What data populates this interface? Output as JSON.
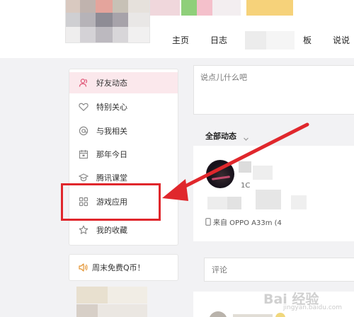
{
  "nav": {
    "items": [
      {
        "label": "主页"
      },
      {
        "label": "日志"
      },
      {
        "label": "板"
      },
      {
        "label": "说说"
      }
    ]
  },
  "sidebar": {
    "items": [
      {
        "label": "好友动态",
        "icon": "friends-icon",
        "active": true
      },
      {
        "label": "特别关心",
        "icon": "heart-icon"
      },
      {
        "label": "与我相关",
        "icon": "at-icon"
      },
      {
        "label": "那年今日",
        "icon": "calendar-icon"
      },
      {
        "label": "腾讯课堂",
        "icon": "graduation-cap-icon"
      },
      {
        "label": "游戏应用",
        "icon": "apps-grid-icon"
      },
      {
        "label": "我的收藏",
        "icon": "star-icon"
      }
    ],
    "promo": {
      "label": "周末免费Q币！",
      "icon": "speaker-icon"
    }
  },
  "main": {
    "status_placeholder": "说点儿什么吧",
    "feed_tab": "全部动态",
    "post": {
      "number_partial": "1C",
      "source": "来自 OPPO A33m (4"
    },
    "comment_placeholder": "评论"
  },
  "watermark": {
    "text": "Bai  经验",
    "sub": "jingyan.baidu.com"
  },
  "colors": {
    "accent": "#e0272c",
    "active_bg": "#fbe8ec",
    "icon_gray": "#8a8a8a"
  }
}
